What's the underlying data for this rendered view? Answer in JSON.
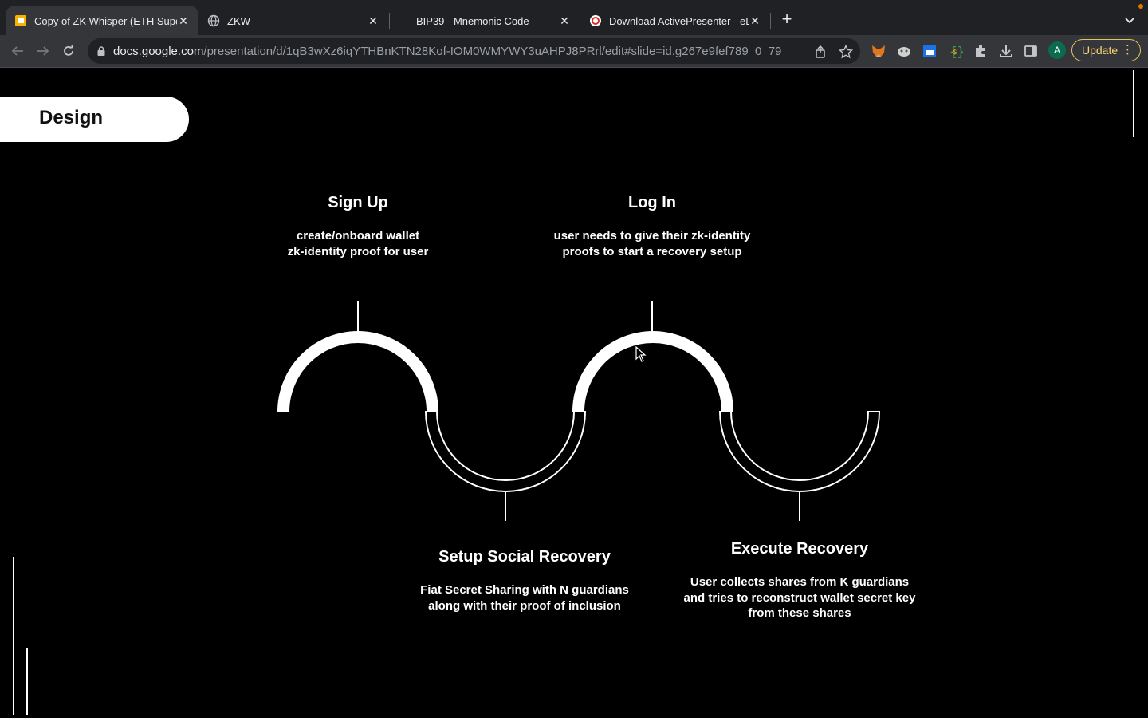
{
  "browser": {
    "tabs": [
      {
        "title": "Copy of ZK Whisper (ETH Supe",
        "icon": "google-slides-icon",
        "active": true
      },
      {
        "title": "ZKW",
        "icon": "globe-icon",
        "active": false
      },
      {
        "title": "BIP39 - Mnemonic Code",
        "icon": "none",
        "active": false
      },
      {
        "title": "Download ActivePresenter - eL",
        "icon": "activepresenter-icon",
        "active": false
      }
    ],
    "url_host": "docs.google.com",
    "url_path": "/presentation/d/1qB3wXz6iqYTHBnKTN28Kof-IOM0WMYWY3uAHPJ8PRrl/edit#slide=id.g267e9fef789_0_79",
    "profile_initial": "A",
    "update_label": "Update",
    "colors": {
      "update_accent": "#fbd976",
      "avatar": "#0b6b4f"
    }
  },
  "slide": {
    "section_title": "Design",
    "steps": [
      {
        "title": "Sign Up",
        "lines": [
          "create/onboard wallet",
          "zk-identity proof for user"
        ]
      },
      {
        "title": "Log In",
        "lines": [
          "user needs to give their zk-identity",
          "proofs to start a recovery setup"
        ]
      },
      {
        "title": "Setup Social Recovery",
        "lines": [
          "Fiat Secret Sharing with N guardians",
          "along with their proof of inclusion"
        ]
      },
      {
        "title": "Execute Recovery",
        "lines": [
          "User collects shares from K guardians",
          "and tries to reconstruct wallet secret key",
          "from these shares"
        ]
      }
    ]
  }
}
